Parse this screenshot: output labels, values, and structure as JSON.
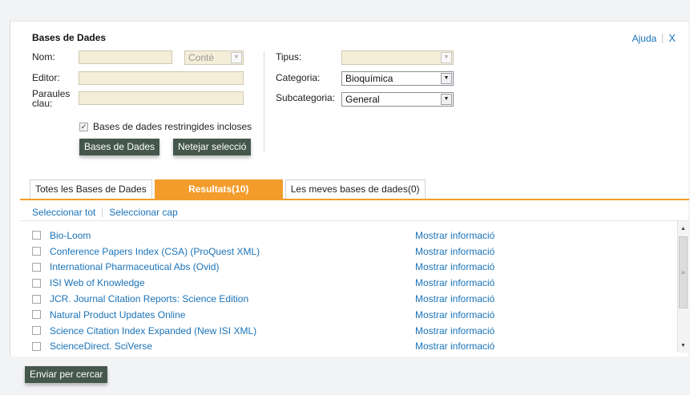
{
  "panel": {
    "title": "Bases de Dades",
    "help_label": "Ajuda",
    "close_label": "X"
  },
  "form": {
    "name_label": "Nom:",
    "name_value": "",
    "contains_option": "Conté",
    "editor_label": "Editor:",
    "editor_value": "",
    "keywords_label": "Paraules clau:",
    "keywords_value": "",
    "type_label": "Tipus:",
    "type_value": "",
    "category_label": "Categoria:",
    "category_value": "Bioquímica",
    "subcategory_label": "Subcategoria:",
    "subcategory_value": "General",
    "restricted_label": "Bases de dades restringides incloses",
    "restricted_checked": true,
    "search_button": "Bases de Dades",
    "clear_button": "Netejar selecció"
  },
  "tabs": [
    {
      "label": "Totes les Bases de Dades",
      "active": false
    },
    {
      "label": "Resultats(10)",
      "active": true
    },
    {
      "label": "Les meves bases de dades(0)",
      "active": false
    }
  ],
  "selection": {
    "select_all": "Seleccionar tot",
    "select_none": "Seleccionar cap"
  },
  "results": [
    {
      "name": "Bio-Loom",
      "info": "Mostrar informació"
    },
    {
      "name": "Conference Papers Index (CSA) (ProQuest XML)",
      "info": "Mostrar informació"
    },
    {
      "name": "International Pharmaceutical Abs (Ovid)",
      "info": "Mostrar informació"
    },
    {
      "name": "ISI Web of Knowledge",
      "info": "Mostrar informació"
    },
    {
      "name": "JCR. Journal Citation Reports: Science Edition",
      "info": "Mostrar informació"
    },
    {
      "name": "Natural Product Updates Online",
      "info": "Mostrar informació"
    },
    {
      "name": "Science Citation Index Expanded (New ISI XML)",
      "info": "Mostrar informació"
    },
    {
      "name": "ScienceDirect. SciVerse",
      "info": "Mostrar informació"
    }
  ],
  "footer": {
    "submit_button": "Enviar per cercar"
  },
  "colors": {
    "accent": "#f39c2b",
    "button": "#45574d",
    "link": "#1a73b8",
    "field": "#f4eed8"
  }
}
